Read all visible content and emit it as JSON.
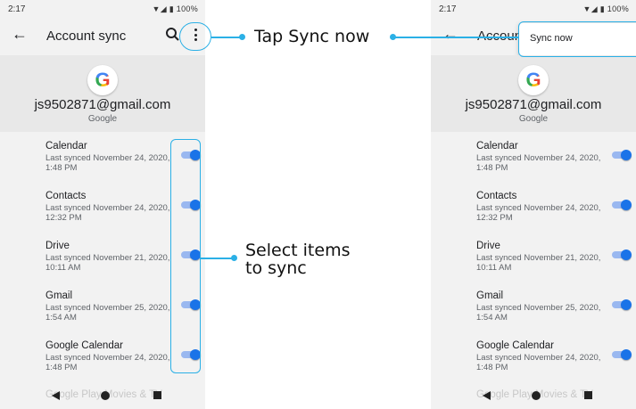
{
  "status": {
    "time": "2:17",
    "battery": "100%",
    "signal_icons": "▼•┃"
  },
  "appbar": {
    "title": "Account sync",
    "back_icon": "←"
  },
  "account": {
    "logo_letter": "G",
    "email": "js9502871@gmail.com",
    "provider": "Google"
  },
  "items": [
    {
      "label": "Calendar",
      "sub": "Last synced November 24, 2020, 1:48 PM",
      "enabled": true
    },
    {
      "label": "Contacts",
      "sub": "Last synced November 24, 2020, 12:32 PM",
      "enabled": true
    },
    {
      "label": "Drive",
      "sub": "Last synced November 21, 2020, 10:11 AM",
      "enabled": true
    },
    {
      "label": "Gmail",
      "sub": "Last synced November 25, 2020, 1:54 AM",
      "enabled": true
    },
    {
      "label": "Google Calendar",
      "sub": "Last synced November 24, 2020, 1:48 PM",
      "enabled": true
    }
  ],
  "faded_item": "Google Play Movies & TV",
  "right_screen": {
    "title_partial": "Account s",
    "menu_item": "Sync now"
  },
  "callouts": {
    "tap_sync": "Tap Sync now",
    "select_items": "Select items to sync"
  },
  "colors": {
    "accent": "#2bb0e6",
    "toggle_on": "#1a73e8"
  }
}
